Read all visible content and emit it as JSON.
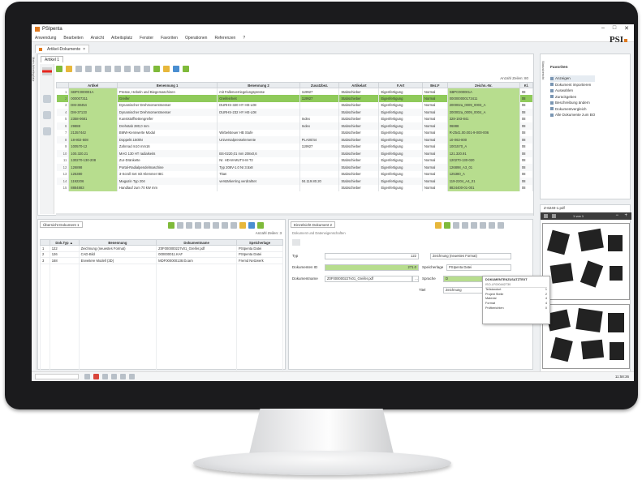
{
  "window": {
    "title": "PSIpenta",
    "controls": [
      "–",
      "□",
      "✕"
    ]
  },
  "brand": "PSI",
  "menu": [
    "Anwendung",
    "Bearbeiten",
    "Ansicht",
    "Arbeitsplatz",
    "Fenster",
    "Favoriten",
    "Operationen",
    "Referenzen",
    "?"
  ],
  "doc_tab": "Artikel-Dokumente",
  "left_vertical_tab": "Mein Arbeitsplatz",
  "sub_tab": "Artikel 1",
  "main_grid": {
    "count_label": "Anzahl Zeilen: 80",
    "columns": [
      "",
      "Artikel",
      "Benennung 1",
      "Benennung 2",
      "Zusatzbez.",
      "Artikelart",
      "F.Art",
      "Bez.F",
      "Zeichn.-Nr.",
      "Kl."
    ],
    "rows": [
      [
        "1",
        "SBPC000001A",
        "Presse, Hebeln und Biegemaschinen",
        "mit Fallenverriegelungspresse",
        "119927",
        "Stabschieber",
        "Eigenfertigung",
        "Normal",
        "SBPC000001A",
        "08"
      ],
      [
        "2",
        "000007311",
        "Greifer",
        "Greifeinheit",
        "119927",
        "Stabschieber",
        "Eigenfertigung",
        "Normal",
        "000000000173411",
        "08"
      ],
      [
        "3",
        "DM-38454",
        "Dynamischer Drehmomentmesser",
        "DURHS-320 HY HE-L08",
        "",
        "Stabschieber",
        "Eigenfertigung",
        "Normal",
        "200002a_0009_0003_A",
        "08"
      ],
      [
        "4",
        "DM-37133",
        "Dynamischer Drehmomentmesser",
        "DURHS-232 HY HE-L08",
        "",
        "Stabschieber",
        "Eigenfertigung",
        "Normal",
        "200002a_0009_0004_A",
        "08"
      ],
      [
        "5",
        "2358-0681",
        "Kunststoffkettengreifer",
        "",
        "Index",
        "Stabschieber",
        "Eigenfertigung",
        "Normal",
        "328-193-841",
        "08"
      ],
      [
        "6",
        "29888",
        "Drehstab 280,0 mm",
        "",
        "Index",
        "Stabschieber",
        "Eigenfertigung",
        "Normal",
        "06888",
        "08"
      ],
      [
        "7",
        "21357442",
        "BMW-Kennwerte Modul",
        "Wirbelsteuer HB Stufe",
        "",
        "Stabschieber",
        "Eigenfertigung",
        "Normal",
        "R-Z541.00.001-9-000-006",
        "08"
      ],
      [
        "8",
        "18-802-508",
        "Doppeltr.150kN",
        "Universalpresselemente",
        "PLA00/44",
        "Stabschieber",
        "Eigenfertigung",
        "Normal",
        "10-063-800",
        "08"
      ],
      [
        "9",
        "100570-12",
        "Zahnrad m10 mm16",
        "",
        "119927",
        "Stabschieber",
        "Eigenfertigung",
        "Normal",
        "1001570_A",
        "08"
      ],
      [
        "10",
        "100.320.21",
        "MAG 130 HT radialseits",
        "BS-0220,01 mm 208x0,6",
        "",
        "Stabschieber",
        "Eigenfertigung",
        "Normal",
        "121.320.91",
        "08"
      ],
      [
        "11",
        "130270-130-208",
        "Zur-Dränkette",
        "Nr. HD-M-MUTS-M T2",
        "",
        "Stabschieber",
        "Eigenfertigung",
        "Normal",
        "120270-130-020",
        "08"
      ],
      [
        "12",
        "126898",
        "Portal-Radialpendelmaschine",
        "Typ 208V-1.0 NI 3.5x8",
        "",
        "Stabschieber",
        "Eigenfertigung",
        "Normal",
        "126898_A3_01",
        "08"
      ],
      [
        "13",
        "125380",
        "3-Scroll Set mit Klemmer IBC",
        "Titan",
        "",
        "Stabschieber",
        "Eigenfertigung",
        "Normal",
        "125380_A",
        "08"
      ],
      [
        "14",
        "1192206",
        "Magazin Typ 204",
        "verstärkerring verdrahtet",
        "04.119.80.20",
        "Stabschieber",
        "Eigenfertigung",
        "Normal",
        "119-2204_A4_01",
        "08"
      ],
      [
        "15",
        "8884883",
        "Handlauf zum 70 kW mm",
        "",
        "",
        "Stabschieber",
        "Eigenfertigung",
        "Normal",
        "8824400-01-001",
        "08"
      ]
    ]
  },
  "bottom_left": {
    "tab": "Übersicht Dokument 1",
    "count_label": "Anzahl Zeilen: 3",
    "columns": [
      "",
      "Dok.Typ ▲",
      "Benennung",
      "Dokumentname",
      "Speicherlage"
    ],
    "rows": [
      [
        "1",
        "122",
        "Zeichnung (neuestes Format)",
        "Z0F000000227v01_Greifer.pdf",
        "PSIpenta Datei"
      ],
      [
        "2",
        "126",
        "CAD-Bild",
        "000000011.KAF",
        "PSIpenta Datei"
      ],
      [
        "3",
        "168",
        "Erweitere Modell (3D)",
        "MDF000000138.tb.iam",
        "Fremd Netzwerk"
      ]
    ]
  },
  "bottom_right": {
    "tab": "Einzelsicht Dokument 2",
    "sub": "Dokument und Dateneigenschaften",
    "fields": {
      "typ_label": "Typ",
      "typ_value": "122",
      "typ_desc": "Zeichnung (neuestes Format)",
      "dok_id_label": "Dokumenten ID",
      "dok_id_value": "271.0",
      "speicherlage_label": "Speicherlage",
      "speicherlage_value": "PSIpenta Datei",
      "dokname_label": "Dokumentname",
      "dokname_value": "Z0F000000227v01_Greifer.pdf",
      "sprache_label": "Sprache",
      "sprache_value": "D",
      "titel_label": "Titel",
      "titel_value": "Zeichnung"
    }
  },
  "popup": {
    "title": "DOKUMENTENZUSATZTEXT",
    "sub": "ISO-LF000442730",
    "rows": [
      [
        "Teilstandort",
        "1"
      ],
      [
        "Projekt Stelle",
        "2"
      ],
      [
        "Material",
        "4"
      ],
      [
        "Format",
        "4"
      ],
      [
        "Prüfberichten",
        "0"
      ]
    ]
  },
  "right_panel": {
    "vertical_tab": "Statusbericht",
    "header": "Favoriten",
    "items": [
      "Anzeigen",
      "Dokument importieren",
      "Auswahlen",
      "Zurückgeben",
      "Beschreibung ändern",
      "Dokumentvergleich",
      "Alle Dokumente zum BO"
    ]
  },
  "pdf_panel": {
    "title": "Z-6240-1.pdf",
    "page": "1 von 1"
  },
  "status": {
    "time": "11:58:36"
  }
}
